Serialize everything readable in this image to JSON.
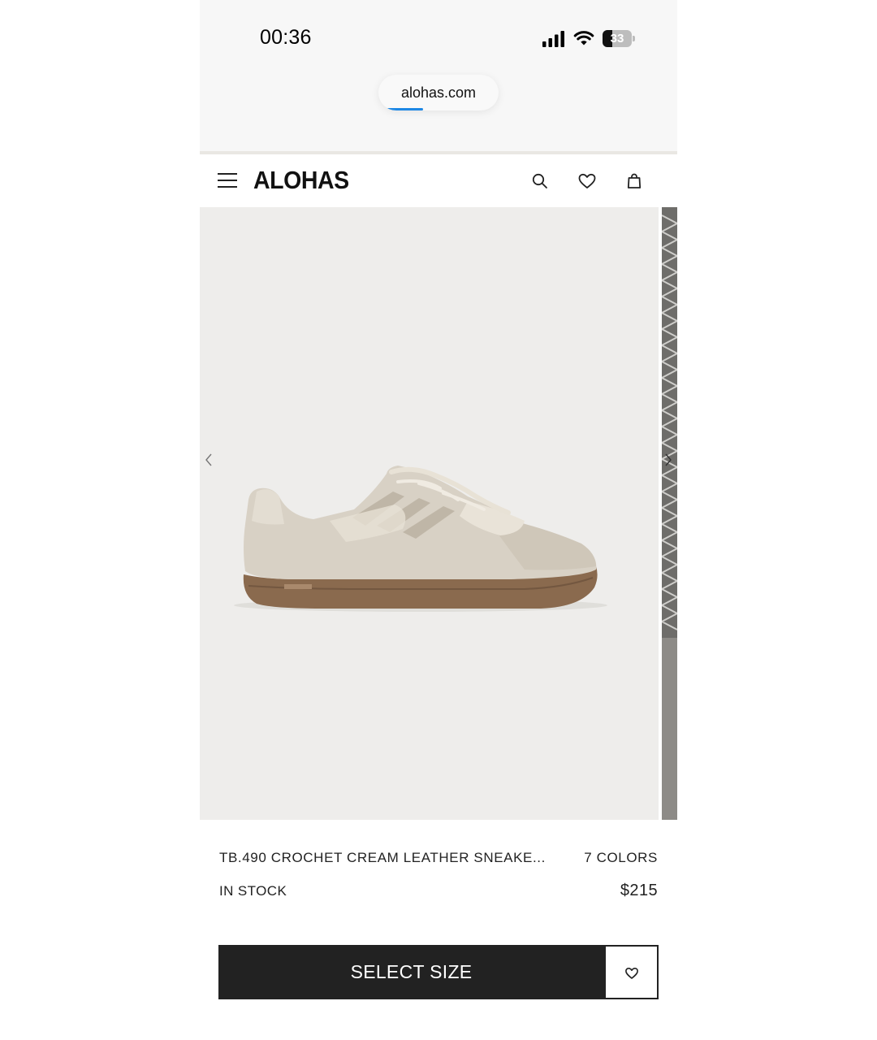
{
  "status_bar": {
    "time": "00:36",
    "battery_level": "33",
    "battery_fraction": 0.33,
    "signal_icon": "cellular-signal-icon",
    "wifi_icon": "wifi-icon"
  },
  "browser": {
    "url": "alohas.com",
    "load_progress": 0.35,
    "progress_color": "#1e88e5"
  },
  "header": {
    "logo": "ALOHAS",
    "menu_icon": "hamburger-menu-icon",
    "search_icon": "search-icon",
    "wishlist_icon": "heart-icon",
    "bag_icon": "shopping-bag-icon"
  },
  "gallery": {
    "prev_icon": "chevron-left-icon",
    "next_icon": "chevron-right-icon",
    "background_color": "#eeedeb"
  },
  "product": {
    "name": "TB.490 CROCHET CREAM LEATHER SNEAKE...",
    "colors": "7 COLORS",
    "stock": "IN STOCK",
    "price": "$215"
  },
  "actions": {
    "select_size_label": "SELECT SIZE",
    "wishlist_icon": "heart-icon",
    "button_color": "#222222"
  }
}
